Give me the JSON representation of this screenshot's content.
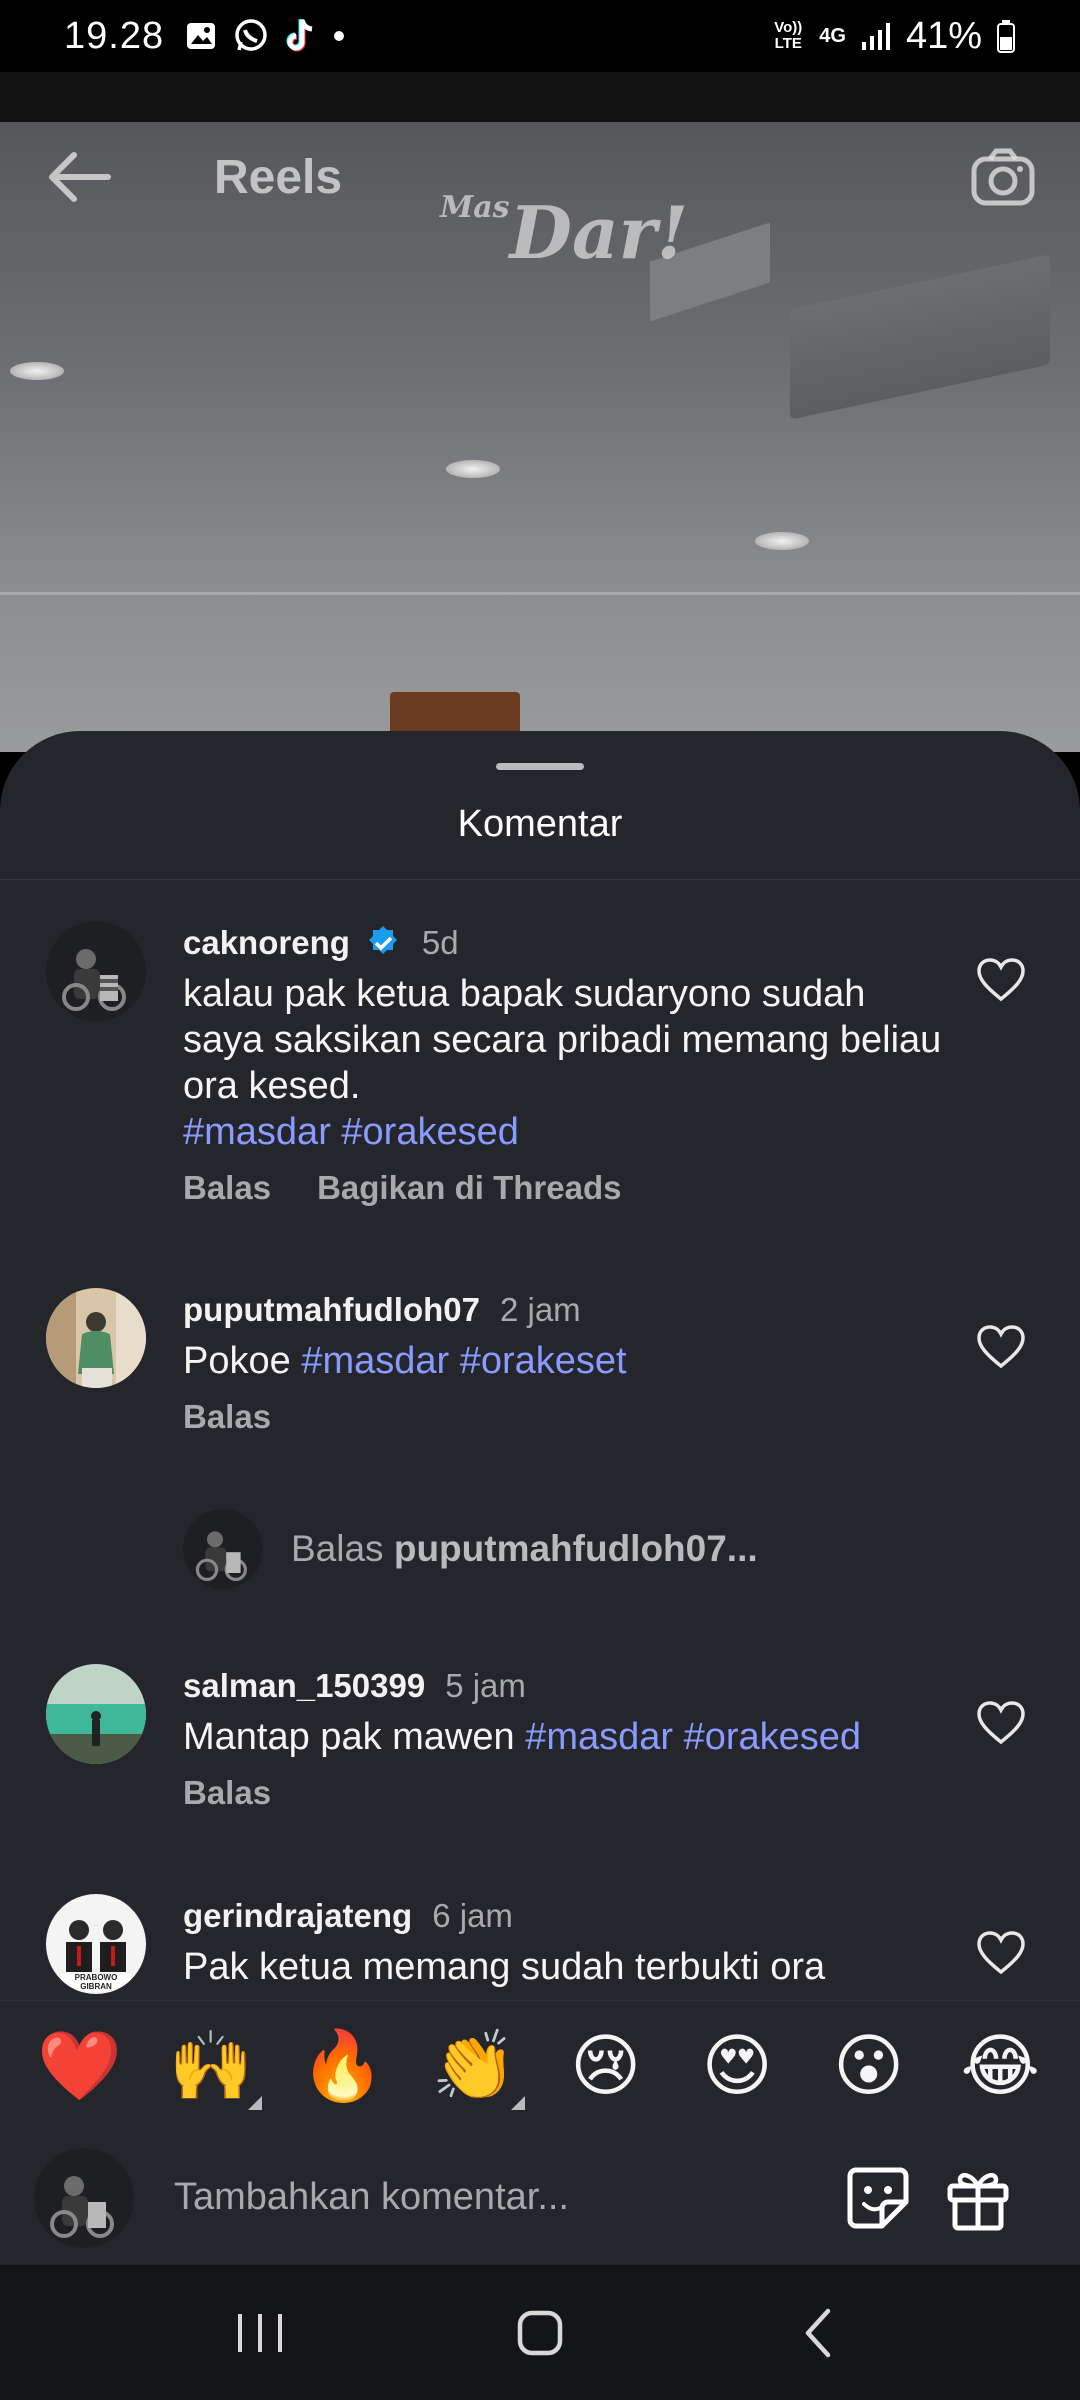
{
  "status_bar": {
    "time": "19.28",
    "left_icons": [
      "gallery-icon",
      "whatsapp-icon",
      "tiktok-icon",
      "dot-icon"
    ],
    "network_volte": "Vo)) LTE",
    "network_4g": "4G",
    "battery": "41%"
  },
  "header": {
    "title": "Reels",
    "watermark_prefix": "Mas",
    "watermark": "Dar!"
  },
  "sheet": {
    "title": "Komentar"
  },
  "comments": [
    {
      "username": "caknoreng",
      "verified": true,
      "time": "5d",
      "text": "kalau pak ketua bapak sudaryono sudah saya saksikan secara pribadi memang beliau ora kesed.",
      "hashtags": "#masdar #orakesed",
      "actions": [
        "Balas",
        "Bagikan di Threads"
      ]
    },
    {
      "username": "puputmahfudloh07",
      "time": "2 jam",
      "text": "Pokoe",
      "hashtags": "#masdar #orakeset",
      "actions": [
        "Balas"
      ]
    },
    {
      "username": "salman_150399",
      "time": "5 jam",
      "text": "Mantap pak mawen",
      "hashtags": "#masdar #orakesed",
      "actions": [
        "Balas"
      ]
    },
    {
      "username": "gerindrajateng",
      "time": "6 jam",
      "text": "Pak ketua memang sudah terbukti ora",
      "avatar_caption": "PRABOWO GIBRAN"
    }
  ],
  "reply_prompt": {
    "prefix": "Balas",
    "target": "puputmahfudloh07..."
  },
  "emoji_bar": [
    "❤️",
    "🙌",
    "🔥",
    "👏",
    "😢",
    "😍",
    "😮",
    "😂"
  ],
  "input": {
    "placeholder": "Tambahkan komentar..."
  },
  "colors": {
    "sheet_bg": "#25262b",
    "hashtag": "#8a9bff",
    "verified": "#1d9bf0",
    "muted": "#a8a9ad"
  }
}
